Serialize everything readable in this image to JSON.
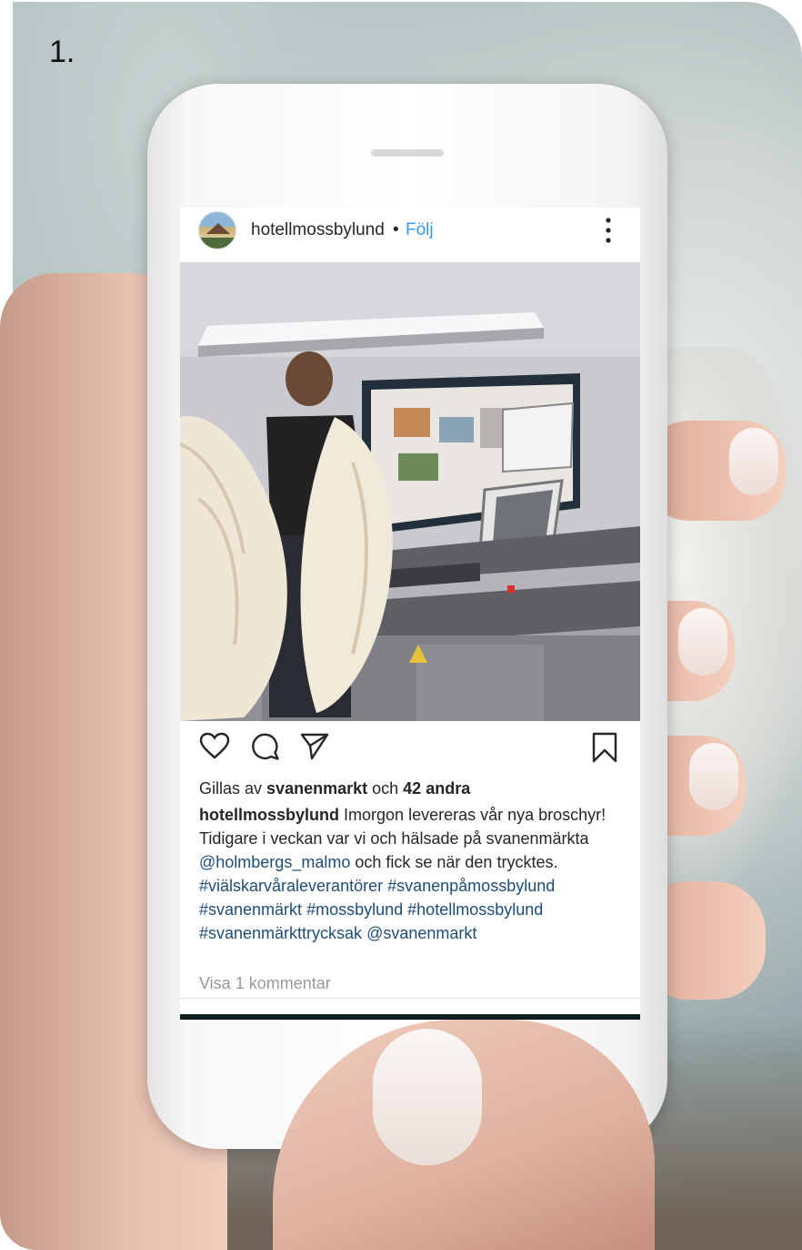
{
  "slide": {
    "number": "1."
  },
  "post": {
    "username": "hotellmossbylund",
    "separator": "•",
    "follow_label": "Följ",
    "likes": {
      "prefix": "Gillas av",
      "liked_by": "svanenmarkt",
      "middle": "och",
      "others": "42 andra"
    },
    "caption": {
      "author": "hotellmossbylund",
      "text_1": "Imorgon levereras vår nya broschyr! Tidigare i veckan var vi och hälsade på svanenmärkta",
      "mention_1": "@holmbergs_malmo",
      "text_2": "och fick se när den trycktes.",
      "hashtag_1": "#viälskarvåraleverantörer",
      "hashtag_2": "#svanenpåmossbylund",
      "hashtag_3": "#svanenmärkt",
      "hashtag_4": "#mossbylund",
      "hashtag_5": "#hotellmossbylund",
      "hashtag_6": "#svanenmärkttrycksak",
      "mention_2": "@svanenmarkt"
    },
    "view_comments": "Visa 1 kommentar"
  },
  "icons": {
    "like": "heart-icon",
    "comment": "comment-icon",
    "share": "send-icon",
    "save": "bookmark-icon",
    "more": "more-vertical-icon"
  },
  "colors": {
    "follow": "#3897f0",
    "link": "#1e4d7a",
    "text": "#262626",
    "muted": "#9a9a9a"
  }
}
